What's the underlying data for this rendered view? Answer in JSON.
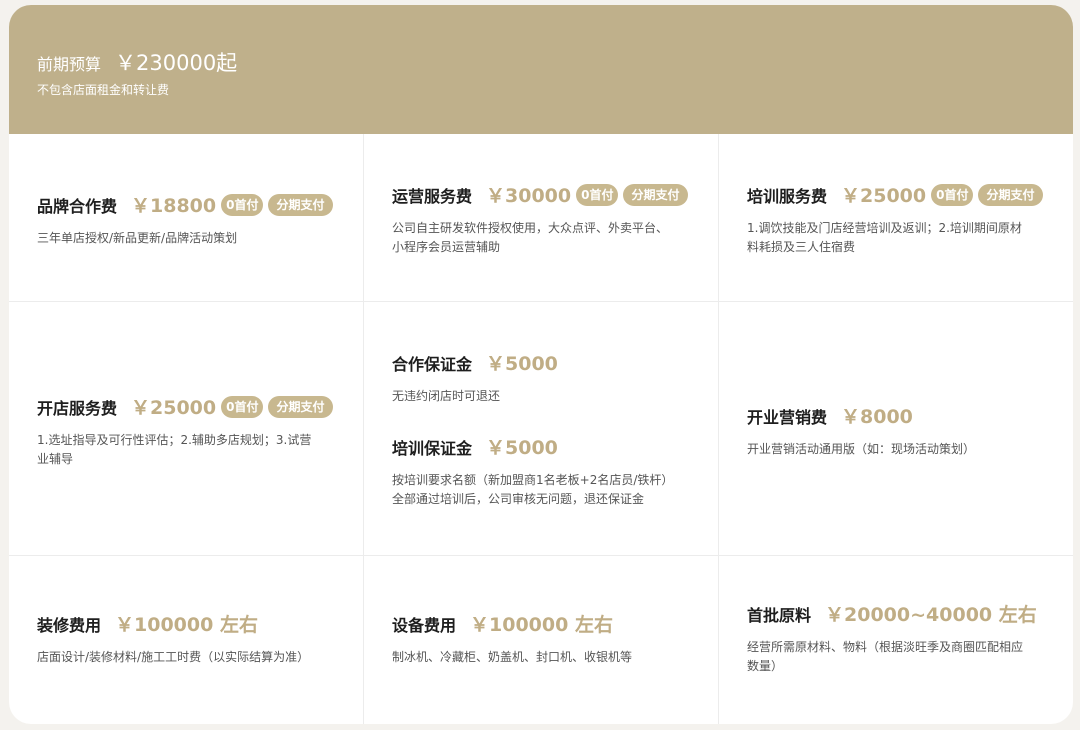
{
  "header": {
    "label": "前期预算",
    "price": "￥230000起",
    "note": "不包含店面租金和转让费"
  },
  "colors": {
    "header_bg": "#bfb08b",
    "accent": "#c0ad85",
    "badge_bg": "#c8b88f"
  },
  "items": {
    "brand": {
      "name": "品牌合作费",
      "price": "￥18800",
      "badge1": "0首付",
      "badge2": "分期支付",
      "desc": "三年单店授权/新品更新/品牌活动策划"
    },
    "operation": {
      "name": "运营服务费",
      "price": "￥30000",
      "badge1": "0首付",
      "badge2": "分期支付",
      "desc1": "公司自主研发软件授权使用，大众点评、外卖平台、",
      "desc2": "小程序会员运营辅助"
    },
    "training": {
      "name": "培训服务费",
      "price": "￥25000",
      "badge1": "0首付",
      "badge2": "分期支付",
      "desc1": "1.调饮技能及门店经营培训及返训；2.培训期间原材",
      "desc2": "料耗损及三人住宿费"
    },
    "opening": {
      "name": "开店服务费",
      "price": "￥25000",
      "badge1": "0首付",
      "badge2": "分期支付",
      "desc1": "1.选址指导及可行性评估；2.辅助多店规划；3.试营",
      "desc2": "业辅导"
    },
    "coop_deposit": {
      "name": "合作保证金",
      "price": "￥5000",
      "desc": "无违约闭店时可退还"
    },
    "train_deposit": {
      "name": "培训保证金",
      "price": "￥5000",
      "desc1": "按培训要求名额（新加盟商1名老板+2名店员/铁杆）",
      "desc2": "全部通过培训后，公司审核无问题，退还保证金"
    },
    "marketing": {
      "name": "开业营销费",
      "price": "￥8000",
      "desc": "开业营销活动通用版（如：现场活动策划）"
    },
    "decoration": {
      "name": "装修费用",
      "price": "￥100000 左右",
      "desc": "店面设计/装修材料/施工工时费（以实际结算为准）"
    },
    "equipment": {
      "name": "设备费用",
      "price": "￥100000 左右",
      "desc": "制冰机、冷藏柜、奶盖机、封口机、收银机等"
    },
    "materials": {
      "name": "首批原料",
      "price": "￥20000~40000 左右",
      "desc1": "经营所需原材料、物料（根据淡旺季及商圈匹配相应",
      "desc2": "数量）"
    }
  }
}
